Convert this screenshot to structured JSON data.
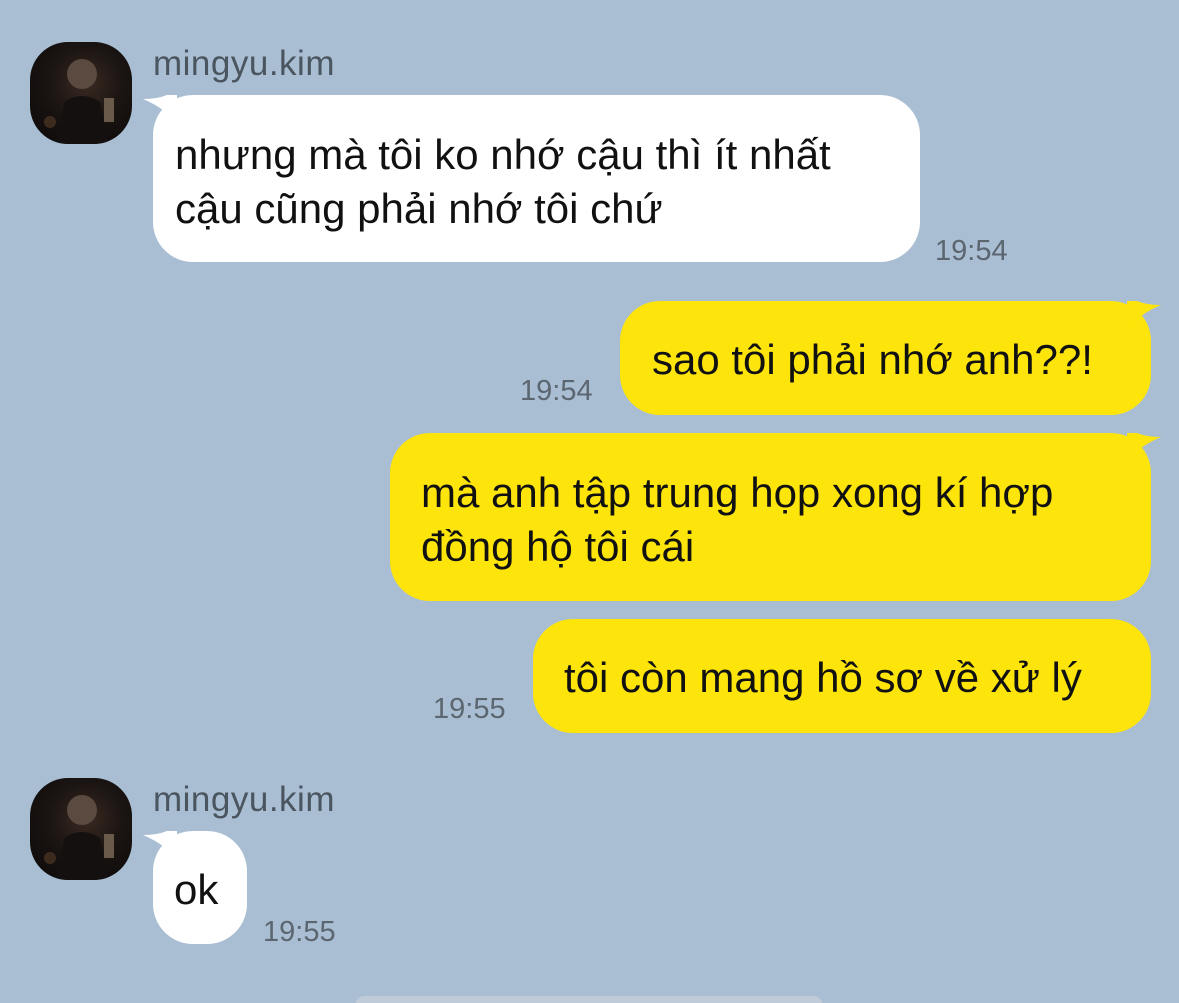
{
  "chat": {
    "background_color": "#a9bed3",
    "incoming_bubble_color": "#ffffff",
    "outgoing_bubble_color": "#fde40a",
    "messages": [
      {
        "direction": "incoming",
        "sender": "mingyu.kim",
        "lines": [
          "nhưng mà tôi ko nhớ cậu thì ít nhất",
          "cậu cũng phải nhớ tôi chứ"
        ],
        "time": "19:54"
      },
      {
        "direction": "outgoing",
        "lines": [
          "sao tôi phải nhớ anh??!"
        ],
        "time": "19:54"
      },
      {
        "direction": "outgoing",
        "lines": [
          "mà anh tập trung họp xong kí hợp",
          "đồng hộ tôi cái"
        ],
        "time": ""
      },
      {
        "direction": "outgoing",
        "lines": [
          "tôi còn mang hồ sơ về xử lý"
        ],
        "time": "19:55"
      },
      {
        "direction": "incoming",
        "sender": "mingyu.kim",
        "lines": [
          "ok"
        ],
        "time": "19:55"
      }
    ]
  }
}
